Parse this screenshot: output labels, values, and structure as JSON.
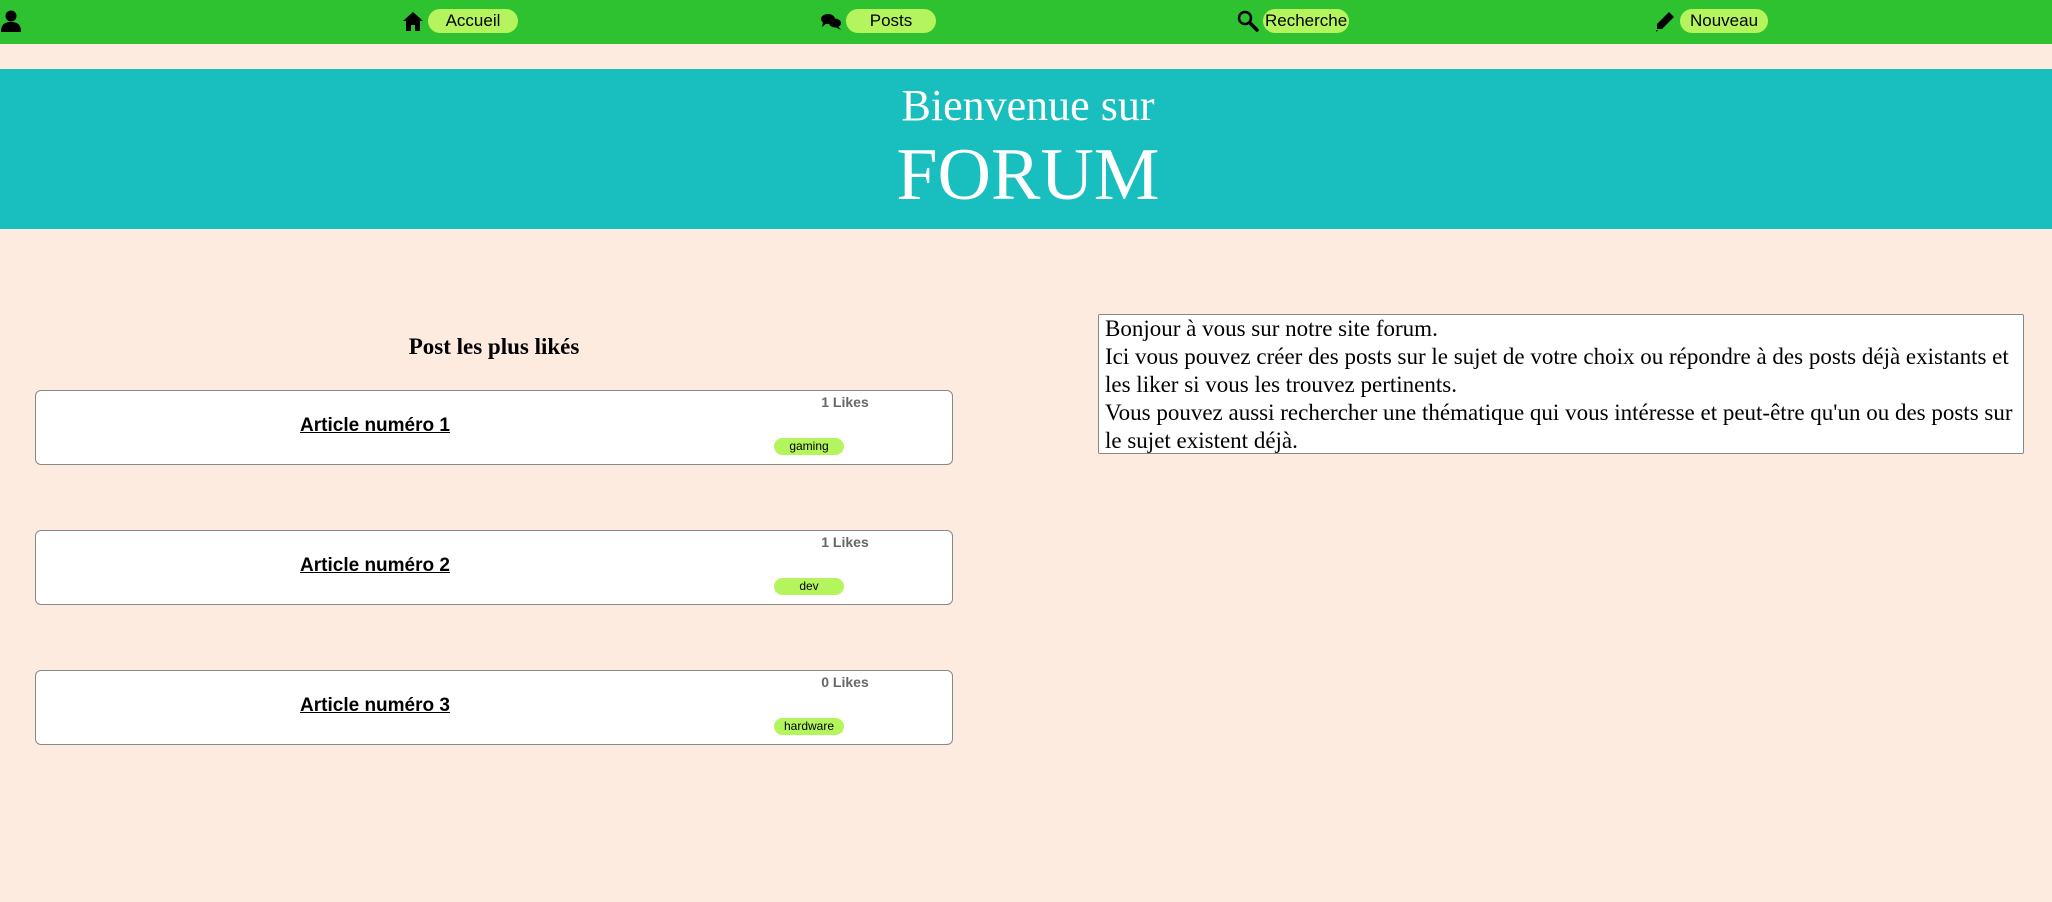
{
  "nav": {
    "user_icon": "user-icon",
    "items": [
      {
        "label": "Accueil",
        "icon": "home-icon"
      },
      {
        "label": "Posts",
        "icon": "chat-bubbles-icon"
      },
      {
        "label": "Recherche",
        "icon": "magnifier-icon"
      },
      {
        "label": "Nouveau",
        "icon": "pen-icon"
      }
    ]
  },
  "hero": {
    "line1": "Bienvenue sur",
    "line2": "FORUM"
  },
  "top_posts": {
    "title": "Post les plus likés",
    "posts": [
      {
        "title": "Article numéro 1",
        "likes": "1 Likes",
        "tag": "gaming"
      },
      {
        "title": "Article numéro 2",
        "likes": "1 Likes",
        "tag": "dev"
      },
      {
        "title": "Article numéro 3",
        "likes": "0 Likes",
        "tag": "hardware"
      }
    ]
  },
  "intro": {
    "line1": "Bonjour à vous sur notre site forum.",
    "line2": "Ici vous pouvez créer des posts sur le sujet de votre choix ou répondre à des posts déjà existants et les liker si vous les trouvez pertinents.",
    "line3": "Vous pouvez aussi rechercher une thématique qui vous intéresse et peut-être qu'un ou des posts sur le sujet existent déjà."
  },
  "colors": {
    "nav_bg": "#2ec230",
    "pill_bg": "#b4f55e",
    "hero_bg": "#19bebe",
    "page_bg": "#fdebe0"
  }
}
